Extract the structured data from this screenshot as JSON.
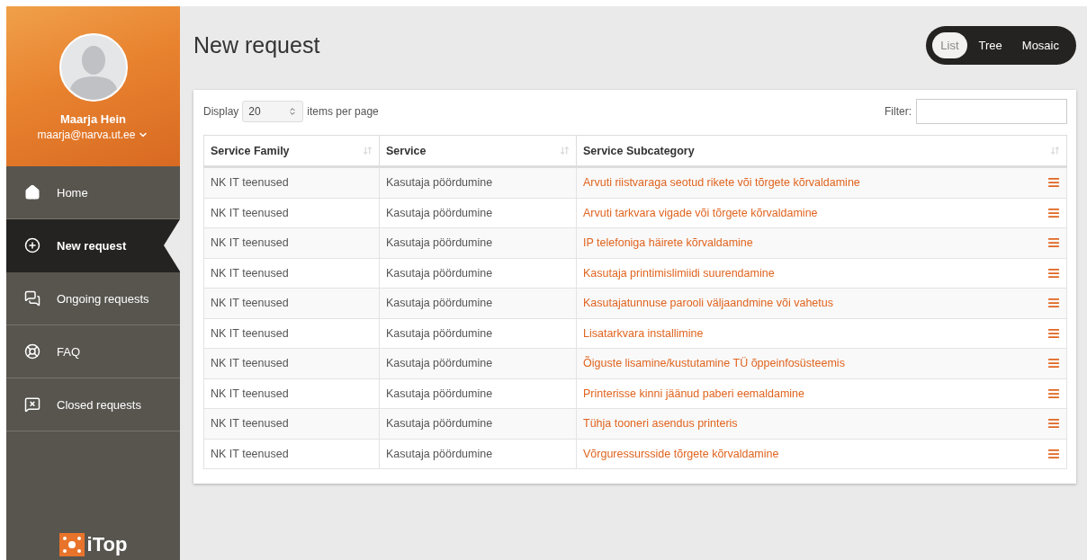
{
  "sidebar": {
    "user": {
      "name": "Maarja Hein",
      "email": "maarja@narva.ut.ee"
    },
    "menu": [
      {
        "label": "Home",
        "kind": "home",
        "selected": false
      },
      {
        "label": "New request",
        "kind": "create",
        "selected": true
      },
      {
        "label": "Ongoing requests",
        "kind": "ongoing",
        "selected": false
      },
      {
        "label": "FAQ",
        "kind": "help",
        "selected": false
      },
      {
        "label": "Closed requests",
        "kind": "closed",
        "selected": false
      }
    ],
    "logo": {
      "text": "iTop"
    }
  },
  "page": {
    "title": "New request"
  },
  "view_switch": [
    {
      "label": "List",
      "selected": true
    },
    {
      "label": "Tree",
      "selected": false
    },
    {
      "label": "Mosaic",
      "selected": false
    }
  ],
  "table_controls": {
    "display_label": "Display",
    "page_size": "20",
    "per_page_label": "items per page",
    "filter_label": "Filter:"
  },
  "table": {
    "columns": [
      "Service Family",
      "Service",
      "Service Subcategory"
    ],
    "rows": [
      [
        "NK IT teenused",
        "Kasutaja pöördumine",
        "Arvuti riistvaraga seotud rikete või tõrgete kõrvaldamine"
      ],
      [
        "NK IT teenused",
        "Kasutaja pöördumine",
        "Arvuti tarkvara vigade või tõrgete kõrvaldamine"
      ],
      [
        "NK IT teenused",
        "Kasutaja pöördumine",
        "IP telefoniga häirete kõrvaldamine"
      ],
      [
        "NK IT teenused",
        "Kasutaja pöördumine",
        "Kasutaja printimislimiidi suurendamine"
      ],
      [
        "NK IT teenused",
        "Kasutaja pöördumine",
        "Kasutajatunnuse parooli väljaandmine või vahetus"
      ],
      [
        "NK IT teenused",
        "Kasutaja pöördumine",
        "Lisatarkvara installimine"
      ],
      [
        "NK IT teenused",
        "Kasutaja pöördumine",
        "Õiguste lisamine/kustutamine TÜ õppeinfosüsteemis"
      ],
      [
        "NK IT teenused",
        "Kasutaja pöördumine",
        "Printerisse kinni jäänud paberi eemaldamine"
      ],
      [
        "NK IT teenused",
        "Kasutaja pöördumine",
        "Tühja tooneri asendus printeris"
      ],
      [
        "NK IT teenused",
        "Kasutaja pöördumine",
        "Võrguressursside tõrgete kõrvaldamine"
      ]
    ]
  }
}
